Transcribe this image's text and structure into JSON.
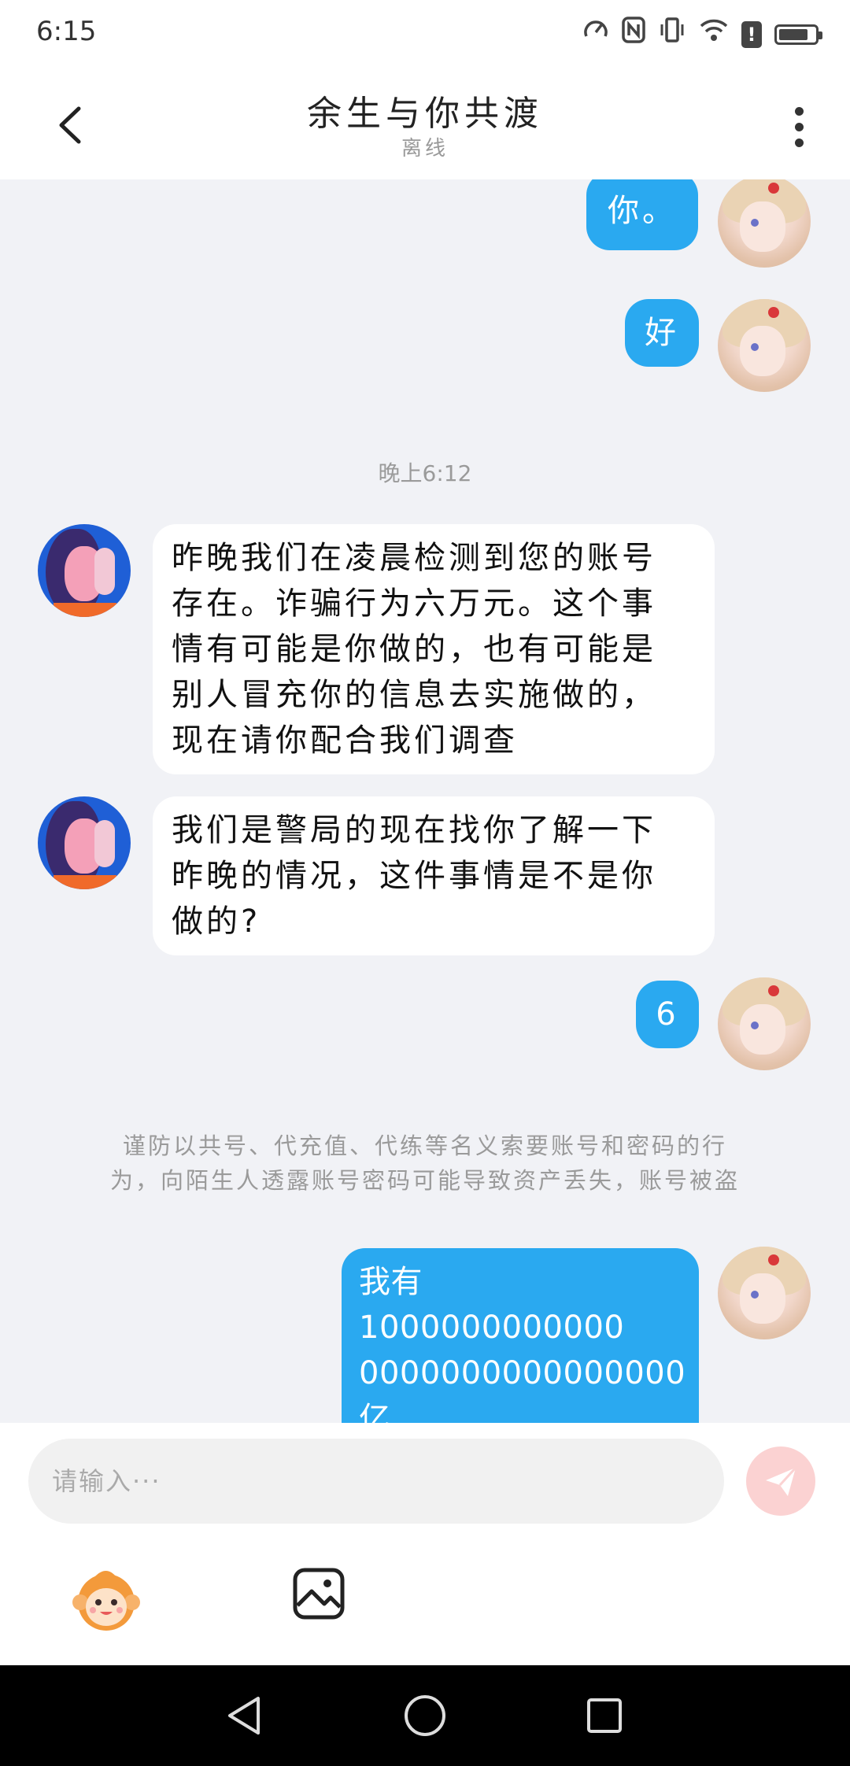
{
  "status_bar": {
    "time": "6:15"
  },
  "header": {
    "title": "余生与你共渡",
    "subtitle": "离线"
  },
  "messages": [
    {
      "from": "me",
      "text": "你。"
    },
    {
      "from": "me",
      "text": "好"
    },
    {
      "from": "system",
      "text": "晚上6:12"
    },
    {
      "from": "other",
      "lines": [
        "昨晚我们在凌晨检测到您的账号",
        "存在。诈骗行为六万元。这个事",
        "情有可能是你做的，也有可能是",
        "别人冒充你的信息去实施做的，",
        "现在请你配合我们调查"
      ]
    },
    {
      "from": "other",
      "lines": [
        "我们是警局的现在找你了解一下",
        "昨晚的情况，这件事情是不是你",
        "做的?"
      ]
    },
    {
      "from": "me",
      "text": "6"
    },
    {
      "from": "system",
      "lines": [
        "谨防以共号、代充值、代练等名义索要账号和密码的行",
        "为，向陌生人透露账号密码可能导致资产丢失，账号被盗"
      ]
    },
    {
      "from": "me",
      "lines": [
        "我有1000000000000",
        "0000000000000000",
        "亿"
      ]
    }
  ],
  "input": {
    "placeholder": "请输入···"
  },
  "colors": {
    "outgoing_bubble": "#2aa9f0",
    "incoming_bubble": "#ffffff",
    "chat_background": "#f1f2f6",
    "send_button": "#fbd2d2"
  }
}
